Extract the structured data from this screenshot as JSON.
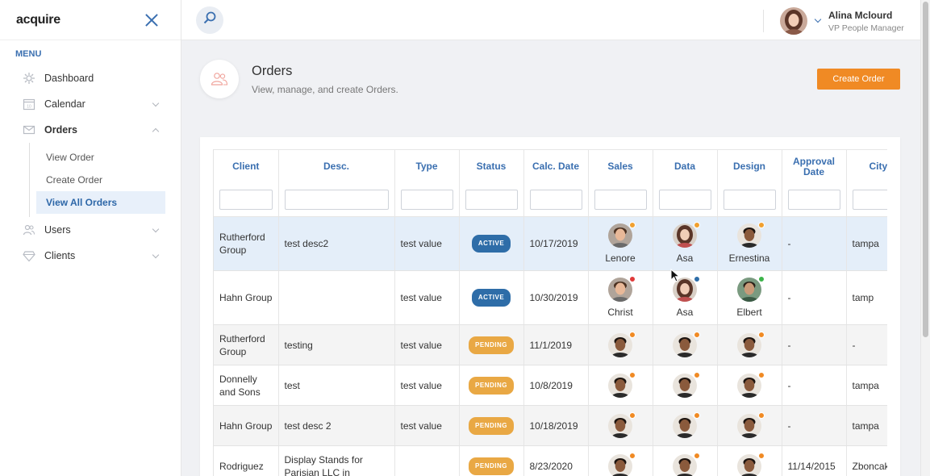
{
  "app": {
    "logo": "acquire"
  },
  "sidebar": {
    "menu_heading": "MENU",
    "items": [
      {
        "label": "Dashboard",
        "icon": "dashboard-icon",
        "has_chevron": false
      },
      {
        "label": "Calendar",
        "icon": "calendar-icon",
        "has_chevron": true
      },
      {
        "label": "Orders",
        "icon": "orders-icon",
        "has_chevron": true,
        "expanded": true
      },
      {
        "label": "Users",
        "icon": "users-icon",
        "has_chevron": true
      },
      {
        "label": "Clients",
        "icon": "clients-icon",
        "has_chevron": true
      }
    ],
    "orders_sub": [
      {
        "label": "View Order"
      },
      {
        "label": "Create Order"
      },
      {
        "label": "View All Orders",
        "active": true
      }
    ]
  },
  "topbar": {
    "user_name": "Alina Mclourd",
    "user_role": "VP People Manager"
  },
  "page": {
    "title": "Orders",
    "subtitle": "View, manage, and create Orders.",
    "create_button": "Create Order"
  },
  "colors": {
    "accent": "#3a6fb0",
    "cta": "#f08a24",
    "active_badge": "#2e6da8",
    "pending_badge": "#e9a844"
  },
  "table": {
    "columns": [
      "Client",
      "Desc.",
      "Type",
      "Status",
      "Calc. Date",
      "Sales",
      "Data",
      "Design",
      "Approval Date",
      "City"
    ],
    "rows": [
      {
        "client": "Rutherford Group",
        "desc": "test desc2",
        "type": "test value",
        "status": "ACTIVE",
        "date": "10/17/2019",
        "sales": {
          "name": "Lenore",
          "avatar": "male-light",
          "dot": "#f0a030"
        },
        "data": {
          "name": "Asa",
          "avatar": "female",
          "dot": "#f0a030"
        },
        "design": {
          "name": "Ernestina",
          "avatar": "male-dark",
          "dot": "#f0a030"
        },
        "approval": "-",
        "city": "tampa",
        "selected": true
      },
      {
        "client": "Hahn Group",
        "desc": "",
        "type": "test value",
        "status": "ACTIVE",
        "date": "10/30/2019",
        "sales": {
          "name": "Christ",
          "avatar": "male-light",
          "dot": "#e03a3a"
        },
        "data": {
          "name": "Asa",
          "avatar": "female",
          "dot": "#2e6da8"
        },
        "design": {
          "name": "Elbert",
          "avatar": "male-green",
          "dot": "#3cb44a"
        },
        "approval": "-",
        "city": "tamp"
      },
      {
        "client": "Rutherford Group",
        "desc": "testing",
        "type": "test value",
        "status": "PENDING",
        "date": "11/1/2019",
        "sales": {
          "name": "",
          "avatar": "male-dark",
          "dot": "#f08a24"
        },
        "data": {
          "name": "",
          "avatar": "male-dark",
          "dot": "#f08a24"
        },
        "design": {
          "name": "",
          "avatar": "male-dark",
          "dot": "#f08a24"
        },
        "approval": "-",
        "city": "-",
        "odd": true
      },
      {
        "client": "Donnelly and Sons",
        "desc": "test",
        "type": "test value",
        "status": "PENDING",
        "date": "10/8/2019",
        "sales": {
          "name": "",
          "avatar": "male-dark",
          "dot": "#f08a24"
        },
        "data": {
          "name": "",
          "avatar": "male-dark",
          "dot": "#f08a24"
        },
        "design": {
          "name": "",
          "avatar": "male-dark",
          "dot": "#f08a24"
        },
        "approval": "-",
        "city": "tampa"
      },
      {
        "client": "Hahn Group",
        "desc": "test desc 2",
        "type": "test value",
        "status": "PENDING",
        "date": "10/18/2019",
        "sales": {
          "name": "",
          "avatar": "male-dark",
          "dot": "#f08a24"
        },
        "data": {
          "name": "",
          "avatar": "male-dark",
          "dot": "#f08a24"
        },
        "design": {
          "name": "",
          "avatar": "male-dark",
          "dot": "#f08a24"
        },
        "approval": "-",
        "city": "tampa",
        "odd": true
      },
      {
        "client": "Rodriguez",
        "desc": "Display Stands for Parisian LLC in",
        "type": "",
        "status": "PENDING",
        "date": "8/23/2020",
        "sales": {
          "name": "",
          "avatar": "male-dark",
          "dot": "#f08a24"
        },
        "data": {
          "name": "",
          "avatar": "male-dark",
          "dot": "#f08a24"
        },
        "design": {
          "name": "",
          "avatar": "male-dark",
          "dot": "#f08a24"
        },
        "approval": "11/14/2015",
        "city": "Zboncak"
      }
    ]
  }
}
